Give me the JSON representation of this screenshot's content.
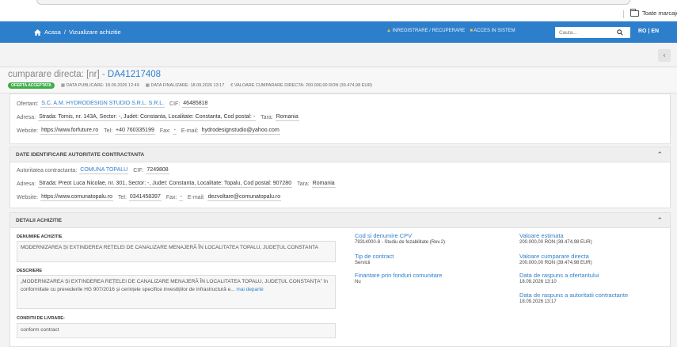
{
  "browser": {
    "bookmarks_label": "Toate marcajele"
  },
  "nav": {
    "home_label": "Acasa",
    "crumb_separator": "/",
    "crumb_current": "Vizualizare achizitie",
    "register_link": "INREGISTRARE / RECUPERARE",
    "login_link": "ACCES IN SISTEM",
    "search_placeholder": "Cauta...",
    "lang_ro": "RO",
    "lang_sep": "|",
    "lang_en": "EN"
  },
  "subbar": {
    "back_label": "‹"
  },
  "header": {
    "title_prefix": "cumparare directa: [nr] -",
    "title_code": "DA41217408",
    "badge": "OFERTA ACCEPTATA",
    "pub_label": "DATA PUBLICARE:",
    "pub_value": "18.09.2026 12:49",
    "fin_label": "DATA FINALIZARE:",
    "fin_value": "18.09.2026 13:17",
    "val_label": "VALOARE CUMPARARE DIRECTA:",
    "val_value": "200.000,00 RON (39.474,98 EUR)"
  },
  "ofertant": {
    "ofertant_label": "Ofertant:",
    "ofertant_name": "S.C. A.M. HYDRODESIGN STUDIO S.R.L. S.R.L.",
    "cif_label": "CIF:",
    "cif_value": "46485818",
    "adresa_label": "Adresa:",
    "adresa_value": "Strada: Tomis, nr. 143A, Sector: -, Judet: Constanta, Localitate: Constanta, Cod postal: -",
    "tara_label": "Tara:",
    "tara_value": "Romania",
    "website_label": "Website:",
    "website_value": "https://www.forfuture.ro",
    "tel_label": "Tel:",
    "tel_value": "+40 760335199",
    "fax_label": "Fax:",
    "fax_value": "-",
    "email_label": "E-mail:",
    "email_value": "hydrodesignstudio@yahoo.com"
  },
  "autoritate": {
    "section_title": "DATE IDENTIFICARE AUTORITATE CONTRACTANTA",
    "aut_label": "Autoritatea contractanta:",
    "aut_name": "COMUNA TOPALU",
    "cif_label": "CIF:",
    "cif_value": "7249808",
    "adresa_label": "Adresa:",
    "adresa_value": "Strada: Preot Luca Nicolae, nr. 301, Sector: -, Judet: Constanta, Localitate: Topalu, Cod postal: 907280",
    "tara_label": "Tara:",
    "tara_value": "Romania",
    "website_label": "Website:",
    "website_value": "https://www.comunatopalu.ro",
    "tel_label": "Tel:",
    "tel_value": "0341458397",
    "fax_label": "Fax:",
    "fax_value": "-",
    "email_label": "E-mail:",
    "email_value": "dezvoltare@comunatopalu.ro"
  },
  "detalii": {
    "section_title": "DETALII ACHIZITIE",
    "denumire_label": "DENUMIRE ACHIZITIE",
    "denumire_value": "MODERNIZAREA ȘI EXTINDEREA REȚELEI DE CANALIZARE MENAJERĂ ÎN LOCALITATEA TOPALU, JUDEȚUL CONSTANTA",
    "descriere_label": "DESCRIERE",
    "descriere_value": "„MODERNIZAREA ȘI EXTINDEREA REȚELEI DE CANALIZARE MENAJERĂ ÎN LOCALITATEA TOPALU, JUDEȚUL CONSTANȚA” în conformitate cu prevederile HG 907/2016 și cerințele specifice investițiilor de infrastructură e...",
    "descriere_more": "mai departe",
    "conditii_label": "CONDITII DE LIVRARE:",
    "conditii_value": "conform contract",
    "cpv_label": "Cod si denumire CPV",
    "cpv_value": "79314000-8 - Studiu de fezabilitate (Rev.2)",
    "tip_label": "Tip de contract",
    "tip_value": "Servicii",
    "fin_label": "Finantare prin fonduri comunitare",
    "fin_value": "Nu",
    "val_est_label": "Valoare estimata",
    "val_est_value": "200.000,00 RON (39.474,98 EUR)",
    "val_cump_label": "Valoare cumparare directa",
    "val_cump_value": "200.000,00 RON (39.474,98 EUR)",
    "raspuns_of_label": "Data de raspuns a ofertantului",
    "raspuns_of_value": "18.09.2026 13:10",
    "raspuns_aut_label": "Data de raspuns a autoritatii contractante",
    "raspuns_aut_value": "18.09.2026 13:17"
  }
}
